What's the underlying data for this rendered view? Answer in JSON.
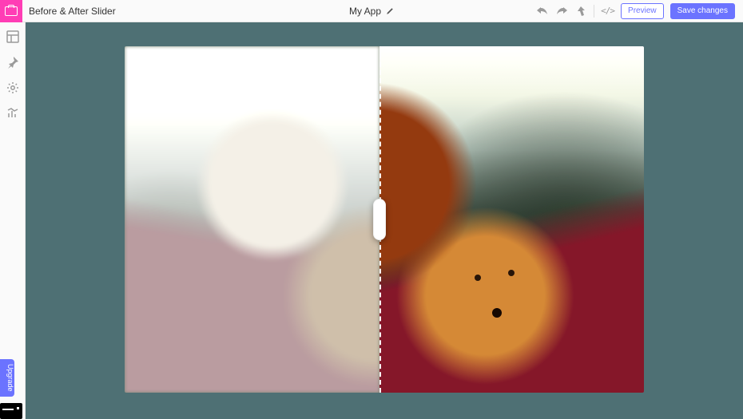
{
  "header": {
    "app_title": "Before & After Slider",
    "project_name": "My App",
    "preview_label": "Preview",
    "save_label": "Save changes"
  },
  "icons": {
    "brand": "camera-icon",
    "edit": "pencil-icon",
    "undo": "undo-icon",
    "redo": "redo-icon",
    "push": "push-arrow-icon",
    "code": "code-icon"
  },
  "sidebar": {
    "items": [
      {
        "name": "layout-icon"
      },
      {
        "name": "pin-icon"
      },
      {
        "name": "gear-icon"
      },
      {
        "name": "chart-icon"
      }
    ],
    "upgrade_label": "Upgrade",
    "footer_label": "brand-badge"
  },
  "canvas": {
    "widget_name": "before-after-slider-widget",
    "slider_position_percent": 49,
    "before_image": "photo-before-hazy",
    "after_image": "photo-after-clear",
    "handle_name": "slider-handle",
    "divider_name": "slider-divider"
  }
}
